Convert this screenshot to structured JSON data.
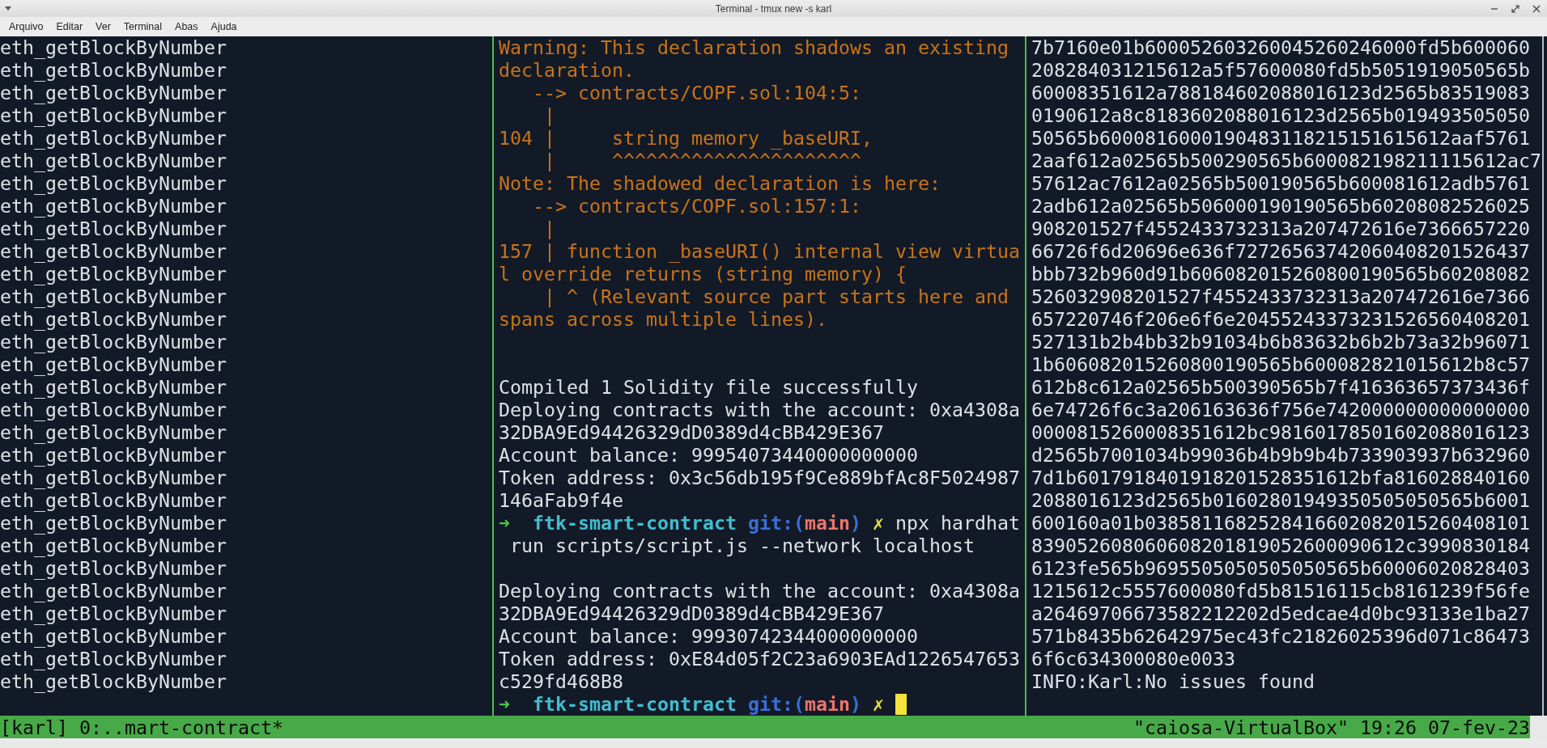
{
  "window": {
    "title": "Terminal - tmux new -s karl"
  },
  "menu": [
    "Arquivo",
    "Editar",
    "Ver",
    "Terminal",
    "Abas",
    "Ajuda"
  ],
  "panes": {
    "left": [
      "eth_getBlockByNumber",
      "eth_getBlockByNumber",
      "eth_getBlockByNumber",
      "eth_getBlockByNumber",
      "eth_getBlockByNumber",
      "eth_getBlockByNumber",
      "eth_getBlockByNumber",
      "eth_getBlockByNumber",
      "eth_getBlockByNumber",
      "eth_getBlockByNumber",
      "eth_getBlockByNumber",
      "eth_getBlockByNumber",
      "eth_getBlockByNumber",
      "eth_getBlockByNumber",
      "eth_getBlockByNumber",
      "eth_getBlockByNumber",
      "eth_getBlockByNumber",
      "eth_getBlockByNumber",
      "eth_getBlockByNumber",
      "eth_getBlockByNumber",
      "eth_getBlockByNumber",
      "eth_getBlockByNumber",
      "eth_getBlockByNumber",
      "eth_getBlockByNumber",
      "eth_getBlockByNumber",
      "eth_getBlockByNumber",
      "eth_getBlockByNumber",
      "eth_getBlockByNumber",
      "eth_getBlockByNumber"
    ],
    "middle": [
      {
        "kind": "warning",
        "text": "Warning: This declaration shadows an existing"
      },
      {
        "kind": "warning",
        "text": "declaration."
      },
      {
        "kind": "warning",
        "text": "   --> contracts/COPF.sol:104:5:"
      },
      {
        "kind": "warning",
        "text": "    |"
      },
      {
        "kind": "warning",
        "text": "104 |     string memory _baseURI,"
      },
      {
        "kind": "warning",
        "text": "    |     ^^^^^^^^^^^^^^^^^^^^^^"
      },
      {
        "kind": "warning",
        "text": "Note: The shadowed declaration is here:"
      },
      {
        "kind": "warning",
        "text": "   --> contracts/COPF.sol:157:1:"
      },
      {
        "kind": "warning",
        "text": "    |"
      },
      {
        "kind": "warning",
        "text": "157 | function _baseURI() internal view virtua"
      },
      {
        "kind": "warning",
        "text": "l override returns (string memory) {"
      },
      {
        "kind": "warning",
        "text": "    | ^ (Relevant source part starts here and"
      },
      {
        "kind": "warning",
        "text": "spans across multiple lines)."
      },
      {
        "kind": "blank"
      },
      {
        "kind": "blank"
      },
      {
        "kind": "output",
        "text": "Compiled 1 Solidity file successfully"
      },
      {
        "kind": "output",
        "text": "Deploying contracts with the account: 0xa4308a"
      },
      {
        "kind": "output",
        "text": "32DBA9Ed94426329dD0389d4cBB429E367"
      },
      {
        "kind": "output",
        "text": "Account balance: 99954073440000000000"
      },
      {
        "kind": "output",
        "text": "Token address: 0x3c56db195f9Ce889bfAc8F5024987"
      },
      {
        "kind": "output",
        "text": "146aFab9f4e"
      },
      {
        "kind": "prompt",
        "arrow": "➜",
        "directory": "ftk-smart-contract",
        "git_open": "git:(",
        "branch": "main",
        "git_close": ")",
        "dirty": "✗",
        "command": "npx hardhat",
        "cursor": false
      },
      {
        "kind": "output",
        "text": " run scripts/script.js --network localhost"
      },
      {
        "kind": "blank"
      },
      {
        "kind": "output",
        "text": "Deploying contracts with the account: 0xa4308a"
      },
      {
        "kind": "output",
        "text": "32DBA9Ed94426329dD0389d4cBB429E367"
      },
      {
        "kind": "output",
        "text": "Account balance: 99930742344000000000"
      },
      {
        "kind": "output",
        "text": "Token address: 0xE84d05f2C23a6903EAd1226547653"
      },
      {
        "kind": "output",
        "text": "c529fd468B8"
      },
      {
        "kind": "prompt",
        "arrow": "➜",
        "directory": "ftk-smart-contract",
        "git_open": "git:(",
        "branch": "main",
        "git_close": ")",
        "dirty": "✗",
        "cursor": true
      }
    ],
    "right": [
      "7b7160e01b600052603260045260246000fd5b600060",
      "208284031215612a5f57600080fd5b5051919050565b",
      "60008351612a788184602088016123d2565b83519083",
      "0190612a8c8183602088016123d2565b019493505050",
      "50565b6000816000190483118215151615612aaf5761",
      "2aaf612a02565b500290565b600082198211115612ac7",
      "57612ac7612a02565b500190565b600081612adb5761",
      "2adb612a02565b506000190190565b60208082526025",
      "908201527f4552433732313a207472616e7366657220",
      "66726f6d20696e636f72726563742060408201526437",
      "bbb732b960d91b606082015260800190565b60208082",
      "526032908201527f4552433732313a207472616e7366",
      "657220746f206e6f6e20455243373231526560408201",
      "527131b2b4bb32b91034b6b83632b6b2b73a32b96071",
      "1b606082015260800190565b600082821015612b8c57",
      "612b8c612a02565b500390565b7f416363657373436f",
      "6e74726f6c3a206163636f756e742000000000000000",
      "0000815260008351612bc98160178501602088016123",
      "d2565b7001034b99036b4b9b9b4b733903937b632960",
      "7d1b6017918401918201528351612bfa816028840160",
      "2088016123d2565b01602801949350505050565b6001",
      "600160a01b0385811682528416602082015260408101",
      "839052608060608201819052600090612c3990830184",
      "6123fe565b9695505050505050565b60006020828403",
      "1215612c5557600080fd5b81516115cb8161239f56fe",
      "a26469706673582212202d5edcae4d0bc93133e1ba27",
      "571b8435b62642975ec43fc21826025396d071c86473",
      "6f6c634300080e0033",
      "INFO:Karl:No issues found"
    ]
  },
  "status_bar": {
    "left": "[karl] 0:..mart-contract*",
    "right": "\"caiosa-VirtualBox\" 19:26 07-fev-23"
  }
}
